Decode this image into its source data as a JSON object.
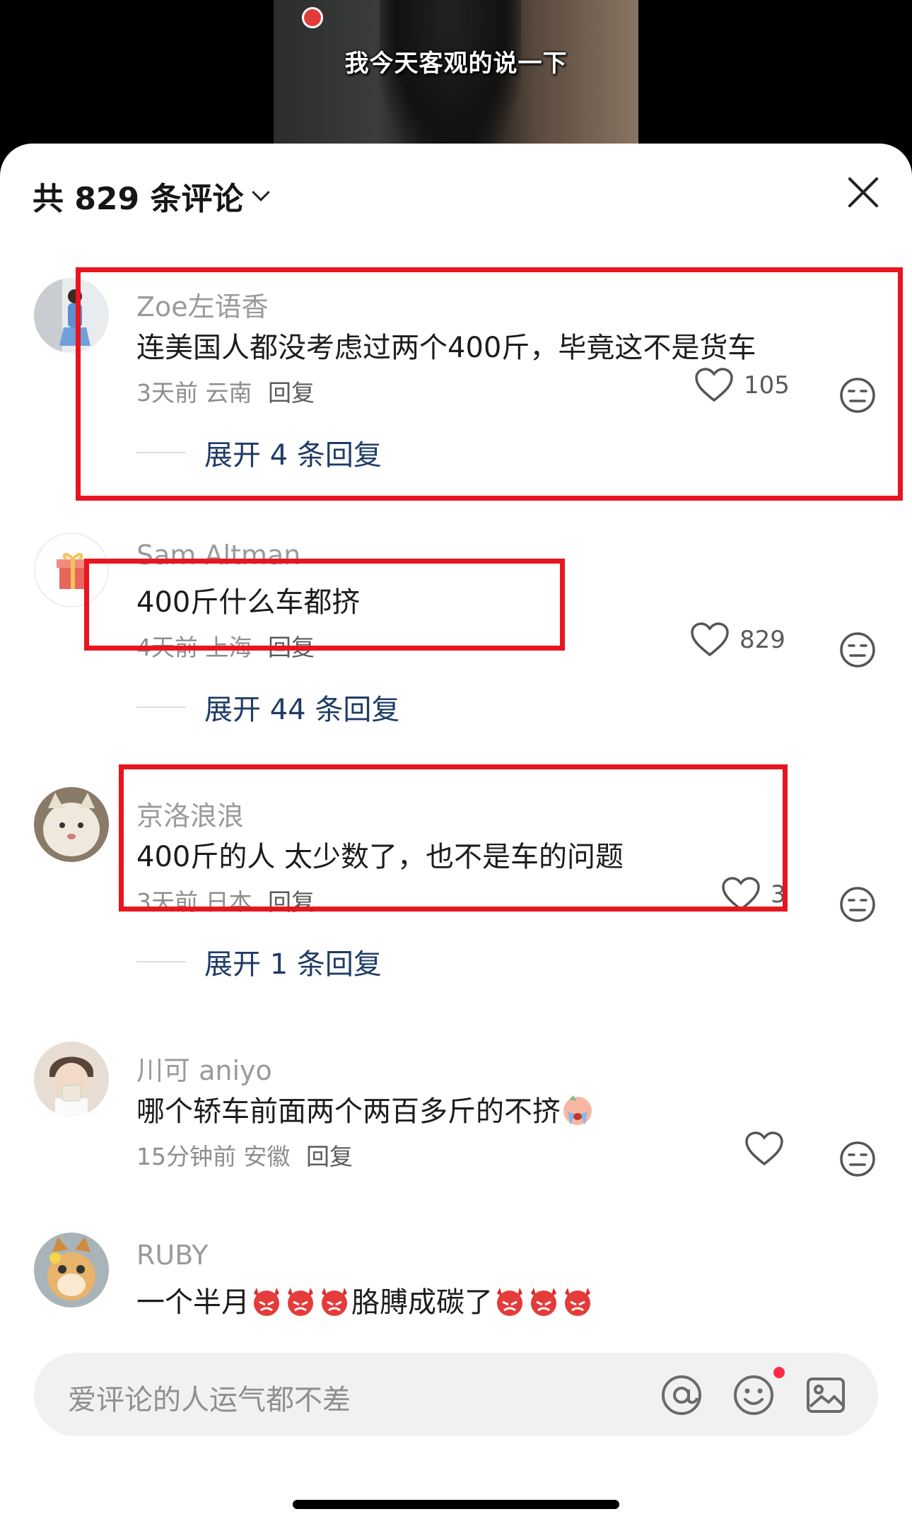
{
  "video": {
    "subtitle": "我今天客观的说一下"
  },
  "header": {
    "title": "共 829 条评论",
    "close_icon": "close-icon"
  },
  "comments": [
    {
      "name": "Zoe左语香",
      "text": "连美国人都没考虑过两个400斤，毕竟这不是货车",
      "time": "3天前",
      "location": "云南",
      "reply": "回复",
      "likes": "105",
      "expand": "展开 4 条回复",
      "avatar_color": "#8fb3d6"
    },
    {
      "name": "Sam Altman",
      "text": "400斤什么车都挤",
      "time": "4天前",
      "location": "上海",
      "reply": "回复",
      "likes": "829",
      "expand": "展开 44 条回复",
      "avatar_color": "#ffffff"
    },
    {
      "name": "京洛浪浪",
      "text": "400斤的人 太少数了，也不是车的问题",
      "time": "3天前",
      "location": "日本",
      "reply": "回复",
      "likes": "3",
      "expand": "展开 1 条回复",
      "avatar_color": "#c9b9a4"
    },
    {
      "name": "川可 aniyo",
      "text": "哪个轿车前面两个两百多斤的不挤",
      "time": "15分钟前",
      "location": "安徽",
      "reply": "回复",
      "likes": "",
      "avatar_color": "#d8c7b8"
    },
    {
      "name": "RUBY",
      "text_a": "一个半月",
      "text_b": "胳膊成碳了",
      "avatar_color": "#e7c27a"
    }
  ],
  "input": {
    "placeholder": "爱评论的人运气都不差"
  },
  "colors": {
    "highlight": "#e8151f",
    "link": "#1f3c66",
    "notification": "#ff2b45"
  }
}
